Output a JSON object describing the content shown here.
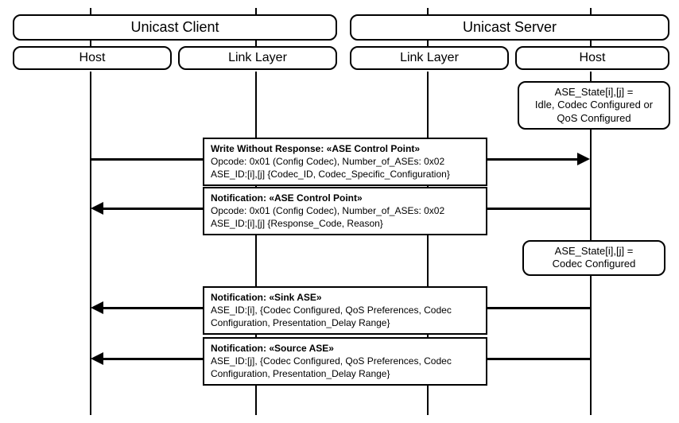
{
  "groups": {
    "client": "Unicast Client",
    "server": "Unicast Server"
  },
  "subs": {
    "client_host": "Host",
    "client_ll": "Link Layer",
    "server_ll": "Link Layer",
    "server_host": "Host"
  },
  "states": {
    "s1_line1": "ASE_State[i],[j] =",
    "s1_line2": "Idle, Codec Configured or",
    "s1_line3": "QoS Configured",
    "s2_line1": "ASE_State[i],[j] =",
    "s2_line2": "Codec Configured"
  },
  "msgs": {
    "m1_title": "Write Without Response: «ASE Control Point»",
    "m1_l1": "Opcode: 0x01 (Config Codec), Number_of_ASEs: 0x02",
    "m1_l2": "ASE_ID:[i],[j] {Codec_ID, Codec_Specific_Configuration}",
    "m2_title": "Notification: «ASE Control Point»",
    "m2_l1": "Opcode: 0x01 (Config Codec), Number_of_ASEs: 0x02",
    "m2_l2": "ASE_ID:[i],[j] {Response_Code, Reason}",
    "m3_title": "Notification: «Sink ASE»",
    "m3_l1": "ASE_ID:[i], {Codec Configured, QoS Preferences, Codec",
    "m3_l2": "Configuration, Presentation_Delay Range}",
    "m4_title": "Notification: «Source ASE»",
    "m4_l1": "ASE_ID:[j], {Codec Configured, QoS Preferences, Codec",
    "m4_l2": "Configuration, Presentation_Delay Range}"
  }
}
